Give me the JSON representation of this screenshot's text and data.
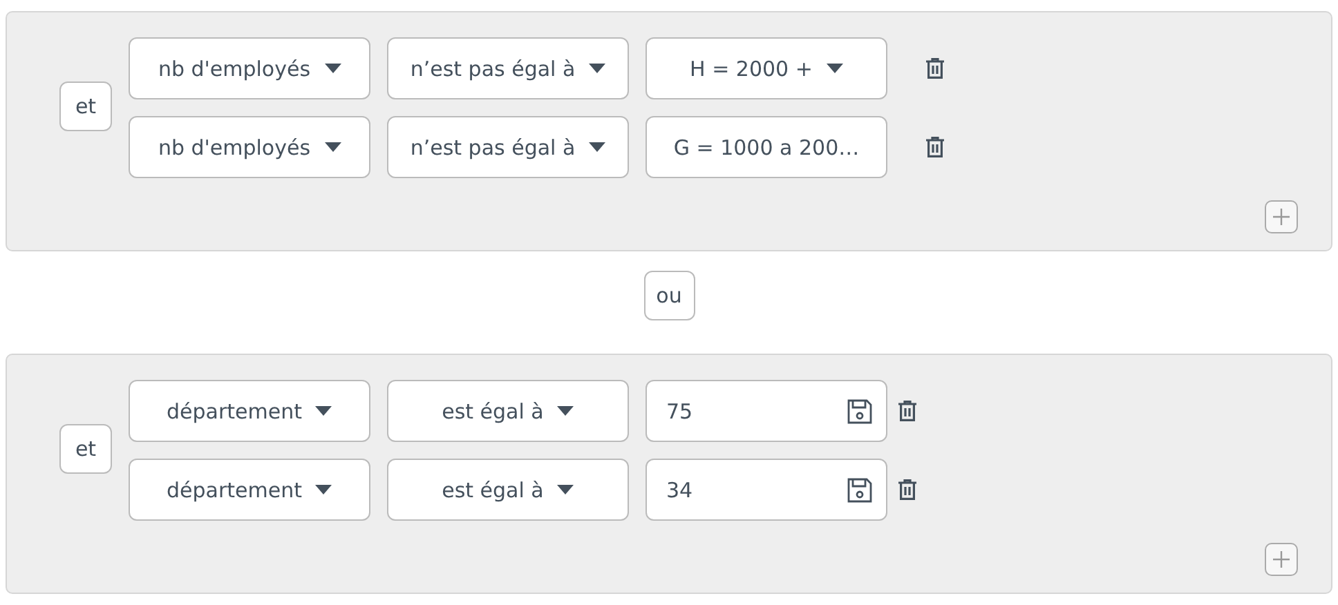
{
  "groups": [
    {
      "connector": "et",
      "rows": [
        {
          "field": "nb d'employés",
          "operator": "n’est pas égal à",
          "value": {
            "kind": "select",
            "text": "H = 2000 +",
            "caret": true
          }
        },
        {
          "field": "nb d'employés",
          "operator": "n’est pas égal à",
          "value": {
            "kind": "select",
            "text": "G = 1000 a 200…",
            "caret": false
          }
        }
      ]
    },
    {
      "connector": "et",
      "rows": [
        {
          "field": "département",
          "operator": "est égal à",
          "value": {
            "kind": "input",
            "text": "75"
          }
        },
        {
          "field": "département",
          "operator": "est égal à",
          "value": {
            "kind": "input",
            "text": "34"
          }
        }
      ]
    }
  ],
  "separator": "ou"
}
